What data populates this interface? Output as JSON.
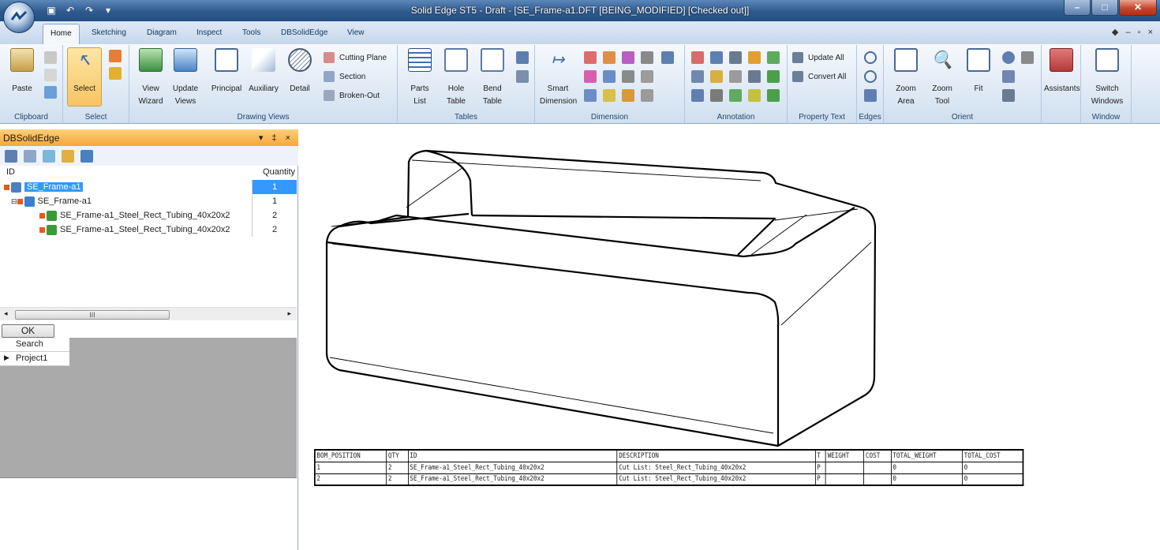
{
  "window": {
    "title": "Solid Edge ST5 - Draft - [SE_Frame-a1.DFT [BEING_MODIFIED] [Checked out]]"
  },
  "tabs": [
    "Home",
    "Sketching",
    "Diagram",
    "Inspect",
    "Tools",
    "DBSolidEdge",
    "View"
  ],
  "ribbon": {
    "clipboard": {
      "label": "Clipboard",
      "paste": "Paste"
    },
    "select": {
      "label": "Select",
      "select": "Select"
    },
    "drawing_views": {
      "label": "Drawing Views",
      "view_wizard_1": "View",
      "view_wizard_2": "Wizard",
      "update_views_1": "Update",
      "update_views_2": "Views",
      "principal": "Principal",
      "auxiliary": "Auxiliary",
      "detail": "Detail",
      "cutting_plane": "Cutting Plane",
      "section": "Section",
      "broken_out": "Broken-Out"
    },
    "tables": {
      "label": "Tables",
      "parts_list_1": "Parts",
      "parts_list_2": "List",
      "hole_table_1": "Hole",
      "hole_table_2": "Table",
      "bend_table_1": "Bend",
      "bend_table_2": "Table"
    },
    "dimension": {
      "label": "Dimension",
      "smart_1": "Smart",
      "smart_2": "Dimension"
    },
    "annotation": {
      "label": "Annotation"
    },
    "property_text": {
      "label": "Property Text",
      "update_all": "Update All",
      "convert_all": "Convert All"
    },
    "edges": {
      "label": "Edges"
    },
    "orient": {
      "label": "Orient",
      "zoom_area_1": "Zoom",
      "zoom_area_2": "Area",
      "zoom_tool_1": "Zoom",
      "zoom_tool_2": "Tool",
      "fit": "Fit"
    },
    "assistants": {
      "label": "Assistants"
    },
    "window": {
      "label": "Window",
      "switch_1": "Switch",
      "switch_2": "Windows"
    }
  },
  "panel": {
    "title": "DBSolidEdge",
    "col_id": "ID",
    "col_qty": "Quantity",
    "rows": [
      {
        "label": "SE_Frame-a1",
        "qty": "1"
      },
      {
        "label": "SE_Frame-a1",
        "qty": "1"
      },
      {
        "label": "SE_Frame-a1_Steel_Rect_Tubing_40x20x2",
        "qty": "2"
      },
      {
        "label": "SE_Frame-a1_Steel_Rect_Tubing_40x20x2",
        "qty": "2"
      }
    ],
    "ok": "OK",
    "grid": [
      "Search",
      "Project1"
    ]
  },
  "bom": {
    "headers": [
      "BOM_POSITION",
      "QTY",
      "ID",
      "DESCRIPTION",
      "T",
      "WEIGHT",
      "COST",
      "TOTAL_WEIGHT",
      "TOTAL_COST"
    ],
    "rows": [
      [
        "1",
        "2",
        "SE_Frame-a1_Steel_Rect_Tubing_40x20x2",
        "Cut List: Steel_Rect_Tubing_40x20x2",
        "P",
        "",
        "",
        "0",
        "0"
      ],
      [
        "2",
        "2",
        "SE_Frame-a1_Steel_Rect_Tubing_40x20x2",
        "Cut List: Steel_Rect_Tubing_40x20x2",
        "P",
        "",
        "",
        "0",
        "0"
      ]
    ]
  }
}
